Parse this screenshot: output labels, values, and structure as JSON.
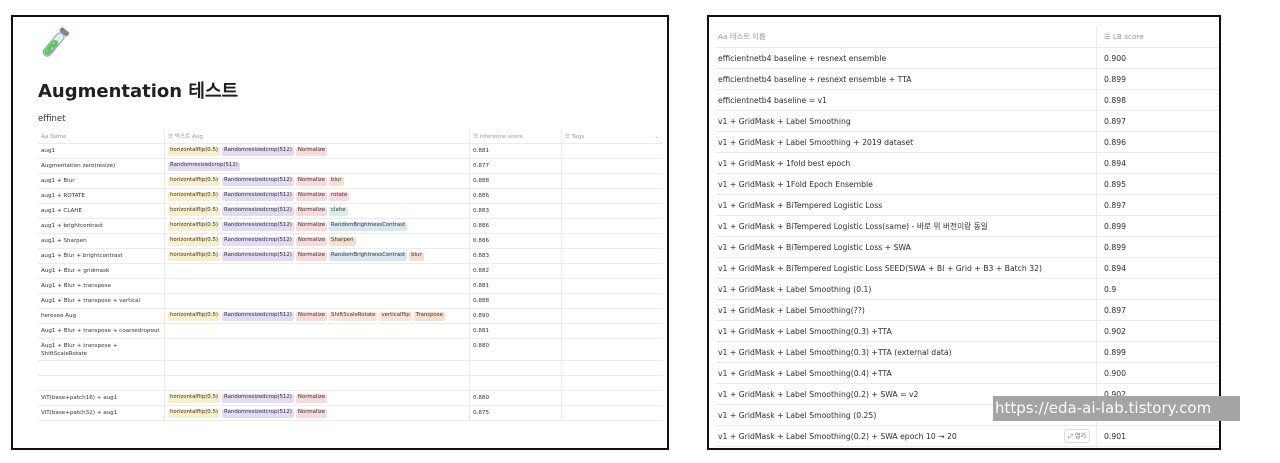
{
  "left_panel": {
    "page_icon": "test-tube-icon",
    "title": "Augmentation 테스트",
    "view_title": "effinet",
    "headers": [
      "Aa Name",
      "☰ 텍스트 Aug",
      "☰ inference score",
      "☰ Tags"
    ],
    "rows": [
      {
        "name": "aug1",
        "tags": [
          "horizontalflip(0.5)",
          "Randomresizedcrop(512)",
          "Normalize"
        ],
        "score": "0.881"
      },
      {
        "name": "Augmentation zero(resize)",
        "tags": [
          "Randomresizedcrop(512)"
        ],
        "score": "0.877"
      },
      {
        "name": "aug1 + Blur",
        "tags": [
          "horizontalflip(0.5)",
          "Randomresizedcrop(512)",
          "Normalize",
          "blur"
        ],
        "score": "0.888"
      },
      {
        "name": "aug1 + ROTATE",
        "tags": [
          "horizontalflip(0.5)",
          "Randomresizedcrop(512)",
          "Normalize",
          "rotate"
        ],
        "score": "0.886"
      },
      {
        "name": "aug1 + CLAHE",
        "tags": [
          "horizontalflip(0.5)",
          "Randomresizedcrop(512)",
          "Normalize",
          "clahe"
        ],
        "score": "0.883"
      },
      {
        "name": "aug1 + brightcontrast",
        "tags": [
          "horizontalflip(0.5)",
          "Randomresizedcrop(512)",
          "Normalize",
          "RandomBrightnessContrast"
        ],
        "score": "0.886"
      },
      {
        "name": "aug1 + Sharpen",
        "tags": [
          "horizontalflip(0.5)",
          "Randomresizedcrop(512)",
          "Normalize",
          "Sharpen"
        ],
        "score": "0.886"
      },
      {
        "name": "aug1 + Blur + brightcontrast",
        "tags": [
          "horizontalflip(0.5)",
          "Randomresizedcrop(512)",
          "Normalize",
          "RandomBrightnessContrast",
          "blur"
        ],
        "score": "0.883"
      },
      {
        "name": "Aug1 + Blur + gridmask",
        "tags": [],
        "score": "0.882"
      },
      {
        "name": "Aug1 + Blur + transpose",
        "tags": [],
        "score": "0.881"
      },
      {
        "name": "Aug1 + Blur + transpose + vertical",
        "tags": [],
        "score": "0.888"
      },
      {
        "name": "heroseo Aug",
        "tags": [
          "horizontalflip(0.5)",
          "Randomresizedcrop(512)",
          "Normalize",
          "ShiftScaleRotate",
          "verticalflip",
          "Transpose"
        ],
        "score": "0.890"
      },
      {
        "name": "Aug1 + Blur + transpose + coarsedropout",
        "tags": [],
        "score": "0.881"
      },
      {
        "name": "Aug1 + Blur + transpose + ShiftScaleRotate",
        "tags": [],
        "score": "0.880"
      },
      {
        "name": "",
        "tags": [],
        "score": ""
      },
      {
        "name": "",
        "tags": [],
        "score": ""
      },
      {
        "name": "ViT(base+patch16) + aug1",
        "tags": [
          "horizontalflip(0.5)",
          "Randomresizedcrop(512)",
          "Normalize"
        ],
        "score": "0.880"
      },
      {
        "name": "ViT(base+patch32) + aug1",
        "tags": [
          "horizontalflip(0.5)",
          "Randomresizedcrop(512)",
          "Normalize"
        ],
        "score": "0.875"
      }
    ],
    "tag_colors": {
      "horizontalflip(0.5)": "#fbeecb",
      "Randomresizedcrop(512)": "#e3dbf5",
      "Normalize": "#f9d9db",
      "blur": "#f8dfcd",
      "rotate": "#f9d9db",
      "clahe": "#d8eee8",
      "RandomBrightnessContrast": "#d6e7f5",
      "Sharpen": "#f8dfcd",
      "ShiftScaleRotate": "#fbe4d6",
      "verticalflip": "#fbe4d6",
      "Transpose": "#f8dfcd"
    }
  },
  "right_panel": {
    "headers": [
      "Aa 테스트 이름",
      "☰ LB score"
    ],
    "open_label": "열기",
    "rows": [
      {
        "name": "efficientnetb4 baseline + resnext ensemble",
        "score": "0.900"
      },
      {
        "name": "efficientnetb4 baseline + resnext ensemble + TTA",
        "score": "0.899"
      },
      {
        "name": "efficientnetb4 baseline = v1",
        "score": "0.898"
      },
      {
        "name": "v1 + GridMask + Label Smoothing",
        "score": "0.897"
      },
      {
        "name": "v1 + GridMask + Label Smoothing + 2019 dataset",
        "score": "0.896"
      },
      {
        "name": "v1 + GridMask + 1fold best epoch",
        "score": "0.894"
      },
      {
        "name": "v1 + GridMask + 1Fold Epoch Ensemble",
        "score": "0.895"
      },
      {
        "name": "v1 + GridMask + BiTempered Logistic Loss",
        "score": "0.897"
      },
      {
        "name": "v1 + GridMask + BiTempered Logistic Loss(same) - 바로 위 버전이랑 동일",
        "score": "0.899"
      },
      {
        "name": "v1 + GridMask + BiTempered Logistic Loss + SWA",
        "score": "0.899"
      },
      {
        "name": "v1 + GridMask + BiTempered Logistic Loss SEED(SWA + BI + Grid + B3 + Batch 32)",
        "score": "0.894"
      },
      {
        "name": "v1 + GridMask + Label Smoothing (0.1)",
        "score": "0.9"
      },
      {
        "name": "v1 + GridMask + Label Smoothing(??)",
        "score": "0.897"
      },
      {
        "name": "v1 + GridMask + Label Smoothing(0.3) +TTA",
        "score": "0.902"
      },
      {
        "name": "v1 + GridMask + Label Smoothing(0.3) +TTA (external data)",
        "score": "0.899"
      },
      {
        "name": "v1 + GridMask + Label Smoothing(0.4) +TTA",
        "score": "0.900"
      },
      {
        "name": "v1 + GridMask + Label Smoothing(0.2) + SWA = v2",
        "score": "0.902"
      },
      {
        "name": "v1 + GridMask + Label Smoothing (0.25)",
        "score": "0.901"
      },
      {
        "name": "v1 + GridMask + Label Smoothing(0.2) + SWA epoch 10 → 20",
        "score": "0.901"
      }
    ]
  },
  "watermark": "https://eda-ai-lab.tistory.com"
}
